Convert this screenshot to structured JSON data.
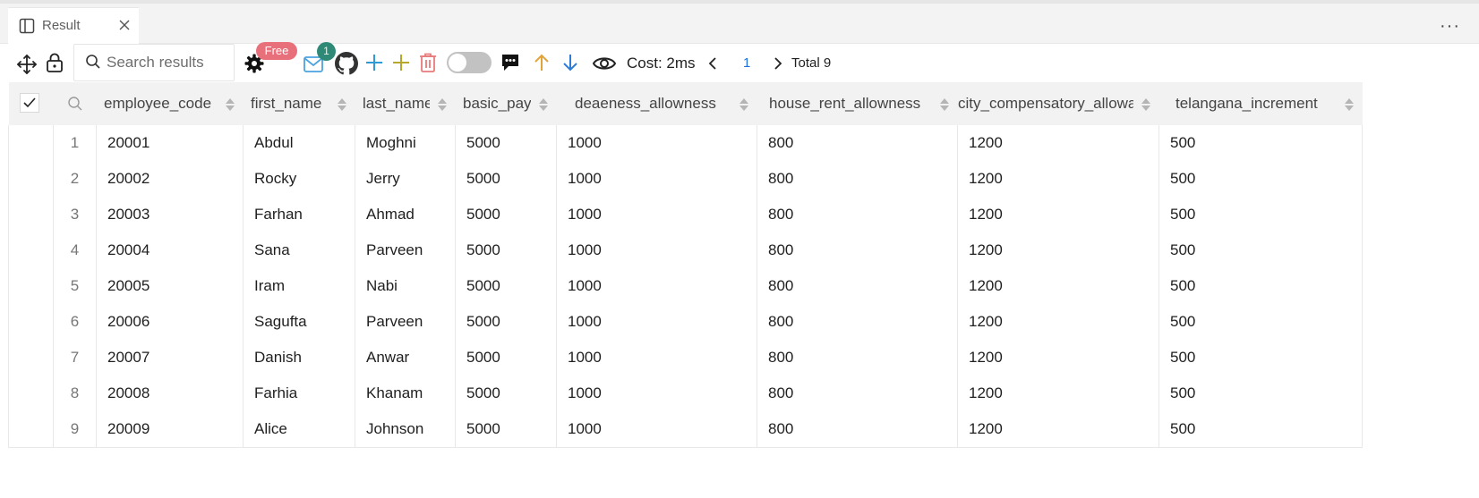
{
  "tab": {
    "title": "Result"
  },
  "toolbar": {
    "search_placeholder": "Search results",
    "free_badge": "Free",
    "message_count": "1",
    "cost": "Cost: 2ms",
    "page": "1",
    "total": "Total 9",
    "colors": {
      "free_badge": "#e8707a",
      "count_badge": "#2e8a77",
      "add": "#2e9bd6",
      "add_alt": "#b5a82a",
      "delete": "#e87a7a",
      "arrow_up": "#e3a33b",
      "arrow_down": "#2e7bd6"
    }
  },
  "table": {
    "columns": [
      "employee_code",
      "first_name",
      "last_name",
      "basic_pay",
      "deaeness_allowness",
      "house_rent_allowness",
      "city_compensatory_allowance",
      "telangana_increment"
    ],
    "rows": [
      [
        "1",
        "20001",
        "Abdul",
        "Moghni",
        "5000",
        "1000",
        "800",
        "1200",
        "500"
      ],
      [
        "2",
        "20002",
        "Rocky",
        "Jerry",
        "5000",
        "1000",
        "800",
        "1200",
        "500"
      ],
      [
        "3",
        "20003",
        "Farhan",
        "Ahmad",
        "5000",
        "1000",
        "800",
        "1200",
        "500"
      ],
      [
        "4",
        "20004",
        "Sana",
        "Parveen",
        "5000",
        "1000",
        "800",
        "1200",
        "500"
      ],
      [
        "5",
        "20005",
        "Iram",
        "Nabi",
        "5000",
        "1000",
        "800",
        "1200",
        "500"
      ],
      [
        "6",
        "20006",
        "Sagufta",
        "Parveen",
        "5000",
        "1000",
        "800",
        "1200",
        "500"
      ],
      [
        "7",
        "20007",
        "Danish",
        "Anwar",
        "5000",
        "1000",
        "800",
        "1200",
        "500"
      ],
      [
        "8",
        "20008",
        "Farhia",
        "Khanam",
        "5000",
        "1000",
        "800",
        "1200",
        "500"
      ],
      [
        "9",
        "20009",
        "Alice",
        "Johnson",
        "5000",
        "1000",
        "800",
        "1200",
        "500"
      ]
    ]
  }
}
